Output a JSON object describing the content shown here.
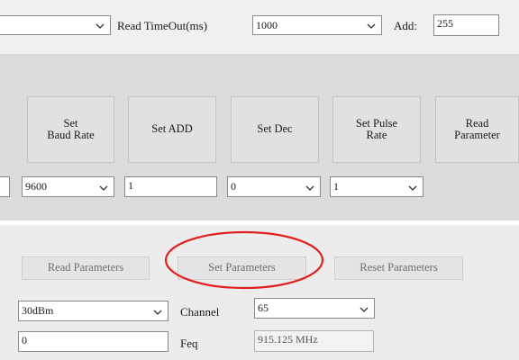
{
  "top_row": {
    "timeout_label": "Read TimeOut(ms)",
    "timeout_value": "1000",
    "add_label": "Add:",
    "add_value": "255"
  },
  "set_buttons": [
    {
      "label": "Set\nBaud Rate"
    },
    {
      "label": "Set ADD"
    },
    {
      "label": "Set Dec"
    },
    {
      "label": "Set Pulse\nRate"
    },
    {
      "label": "Read\nParameter"
    }
  ],
  "set_inputs": {
    "baud_rate": "9600",
    "add": "1",
    "dec": "0",
    "pulse_rate": "1"
  },
  "param_buttons": {
    "read": "Read Parameters",
    "set": "Set Parameters",
    "reset": "Reset Parameters"
  },
  "rf": {
    "power_value": "30dBm",
    "channel_label": "Channel",
    "channel_value": "65",
    "power_offset_value": "0",
    "freq_label": "Feq",
    "freq_value": "915.125 MHz"
  },
  "highlight_color": "#e0201f"
}
